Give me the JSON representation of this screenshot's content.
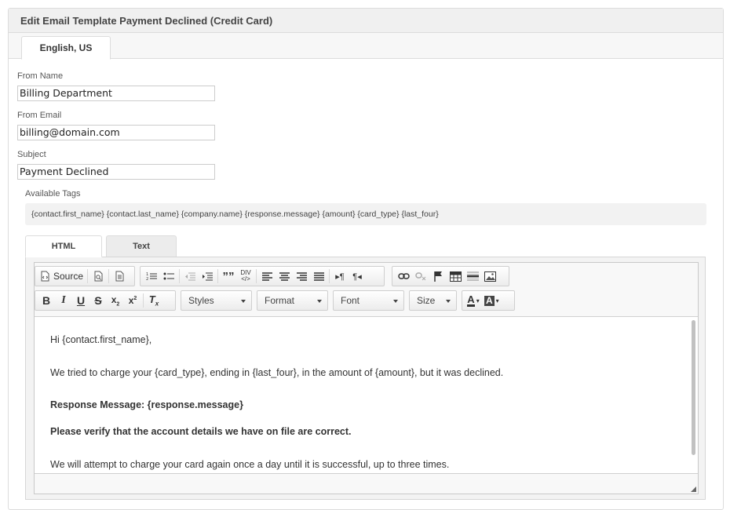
{
  "panel": {
    "title": "Edit Email Template Payment Declined (Credit Card)",
    "language_tab": "English, US"
  },
  "form": {
    "from_name_label": "From Name",
    "from_name_value": "Billing Department",
    "from_email_label": "From Email",
    "from_email_value": "billing@domain.com",
    "subject_label": "Subject",
    "subject_value": "Payment Declined",
    "tags_label": "Available Tags",
    "tags_value": "{contact.first_name} {contact.last_name} {company.name} {response.message} {amount} {card_type} {last_four}"
  },
  "editor_tabs": [
    "HTML",
    "Text"
  ],
  "toolbar": {
    "source_label": "Source",
    "styles_label": "Styles",
    "format_label": "Format",
    "font_label": "Font",
    "size_label": "Size",
    "icons_row1": [
      "source-icon",
      "preview-icon",
      "templates-icon",
      "numbered-list-icon",
      "bulleted-list-icon",
      "outdent-icon",
      "indent-icon",
      "blockquote-icon",
      "div-icon",
      "align-left-icon",
      "align-center-icon",
      "align-right-icon",
      "justify-icon",
      "ltr-icon",
      "rtl-icon",
      "link-icon",
      "unlink-icon",
      "anchor-icon",
      "table-icon",
      "horizontal-rule-icon",
      "image-icon"
    ],
    "icons_row2": [
      "bold-icon",
      "italic-icon",
      "underline-icon",
      "strikethrough-icon",
      "subscript-icon",
      "superscript-icon",
      "remove-format-icon",
      "text-color-icon",
      "background-color-icon"
    ]
  },
  "content": {
    "line1": "Hi {contact.first_name},",
    "line2": "We tried to charge your {card_type}, ending in {last_four}, in the amount of {amount}, but it was declined.",
    "line3": "Response Message: {response.message}",
    "line4": "Please verify that the account details we have on file are correct.",
    "line5": "We will attempt to charge your card again once a day until it is successful, up to three times."
  }
}
